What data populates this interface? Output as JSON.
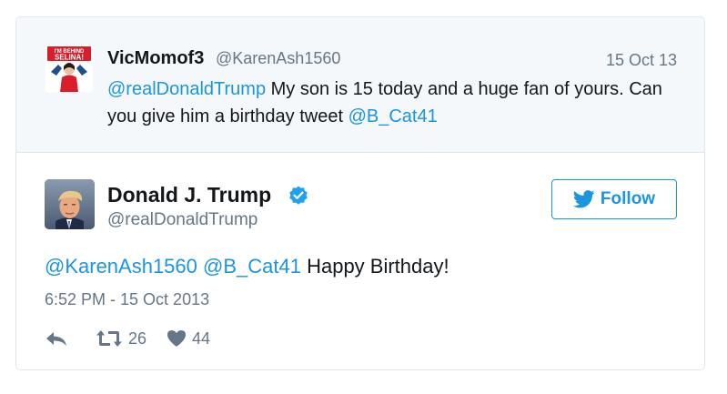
{
  "parent_tweet": {
    "display_name": "VicMomof3",
    "handle": "@KarenAsh1560",
    "date": "15 Oct 13",
    "mention": "@realDonaldTrump",
    "text_part1": " My son is 15 today and a huge fan of yours. Can you give him a birthday tweet ",
    "mention2": "@B_Cat41",
    "avatar_text_line1": "I'M BEHIND",
    "avatar_text_line2": "SELINA!"
  },
  "tweet": {
    "display_name": "Donald J. Trump",
    "handle": "@realDonaldTrump",
    "mention1": "@KarenAsh1560",
    "mention2": "@B_Cat41",
    "text": " Happy Birthday!",
    "timestamp": "6:52 PM - 15 Oct 2013",
    "retweet_count": "26",
    "like_count": "44"
  },
  "follow_button": {
    "label": "Follow"
  },
  "colors": {
    "link": "#1b95e0",
    "text": "#14171a",
    "muted": "#657786",
    "border": "#e1e8ed",
    "parent_bg": "#f5f8fa"
  }
}
